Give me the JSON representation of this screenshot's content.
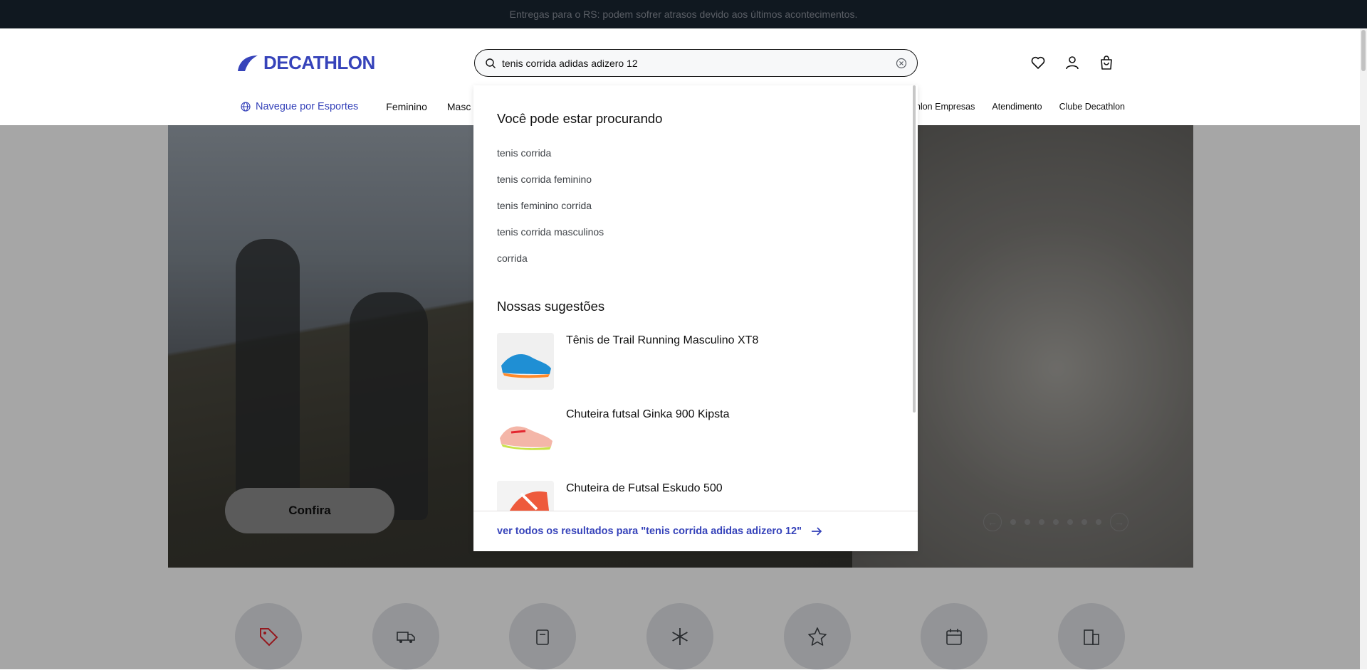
{
  "banner": {
    "text": "Entregas para o RS: podem sofrer atrasos devido aos últimos acontecimentos."
  },
  "header": {
    "logo_text": "DECATHLON",
    "search_value": "tenis corrida adidas adizero 12",
    "icons": [
      "heart-icon",
      "user-icon",
      "cart-icon"
    ]
  },
  "nav": {
    "sports_label": "Navegue por Esportes",
    "items": [
      "Feminino",
      "Masc"
    ],
    "right_items": [
      "thlon Empresas",
      "Atendimento",
      "Clube Decathlon"
    ]
  },
  "hero": {
    "cta_label": "Confira",
    "slide_count": 7
  },
  "dropdown": {
    "suggestions_title": "Você pode estar procurando",
    "suggestions": [
      "tenis corrida",
      "tenis corrida feminino",
      "tenis feminino corrida",
      "tenis corrida masculinos",
      "corrida"
    ],
    "products_title": "Nossas sugestões",
    "products": [
      {
        "name": "Tênis de Trail Running Masculino XT8"
      },
      {
        "name": "Chuteira futsal Ginka 900 Kipsta"
      },
      {
        "name": "Chuteira de Futsal Eskudo 500"
      }
    ],
    "see_all": "ver todos os resultados para \"tenis corrida adidas adizero 12\""
  },
  "categories": [
    "tag-icon",
    "truck-icon",
    "store-icon",
    "snowflake-icon",
    "star-icon",
    "calendar-icon",
    "building-icon"
  ],
  "colors": {
    "brand": "#3643ba",
    "banner_bg": "#101820"
  }
}
